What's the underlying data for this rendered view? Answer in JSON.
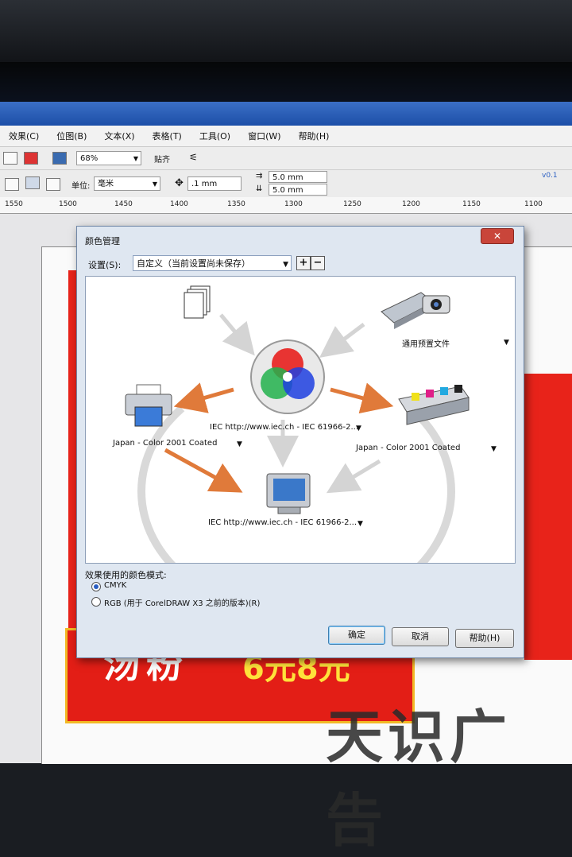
{
  "menubar": {
    "items": [
      "效果(C)",
      "位图(B)",
      "文本(X)",
      "表格(T)",
      "工具(O)",
      "窗口(W)",
      "帮助(H)"
    ]
  },
  "toolbar": {
    "zoom_value": "68%",
    "snap_label": "贴齐",
    "units_label": "单位:",
    "units_value": "毫米",
    "nudge_value": ".1 mm",
    "dup_x": "5.0 mm",
    "dup_y": "5.0 mm",
    "version_badge": "v0.1"
  },
  "ruler": {
    "ticks": [
      "1550",
      "1500",
      "1450",
      "1400",
      "1350",
      "1300",
      "1250",
      "1200",
      "1150",
      "1100"
    ]
  },
  "poster": {
    "text1": "汤粉",
    "text2": "6元8元",
    "watermark": "天识广告"
  },
  "dialog": {
    "title": "颜色管理",
    "close_glyph": "✕",
    "settings_label": "设置(S):",
    "settings_value": "自定义（当前设置尚未保存）",
    "add_glyph": "+",
    "remove_glyph": "−",
    "source_label": "通用预置文件",
    "center_profile": "IEC http://www.iec.ch - IEC 61966-2...",
    "printer_profile": "Japan - Color 2001 Coated",
    "press_profile": "Japan - Color 2001 Coated",
    "monitor_profile": "IEC http://www.iec.ch - IEC 61966-2...",
    "dropdown_glyph": "▼",
    "mode_label": "效果使用的颜色模式:",
    "mode_options": [
      "CMYK",
      "RGB (用于 CorelDRAW X3 之前的版本)(R)"
    ],
    "selected_mode": "CMYK",
    "buttons": {
      "ok": "确定",
      "cancel": "取消",
      "help": "帮助(H)"
    }
  },
  "colors": {
    "accent_arrow": "#e07a3a",
    "dialog_bg": "#dfe7f1",
    "poster_red": "#e31e16",
    "poster_gold": "#f2b925"
  }
}
